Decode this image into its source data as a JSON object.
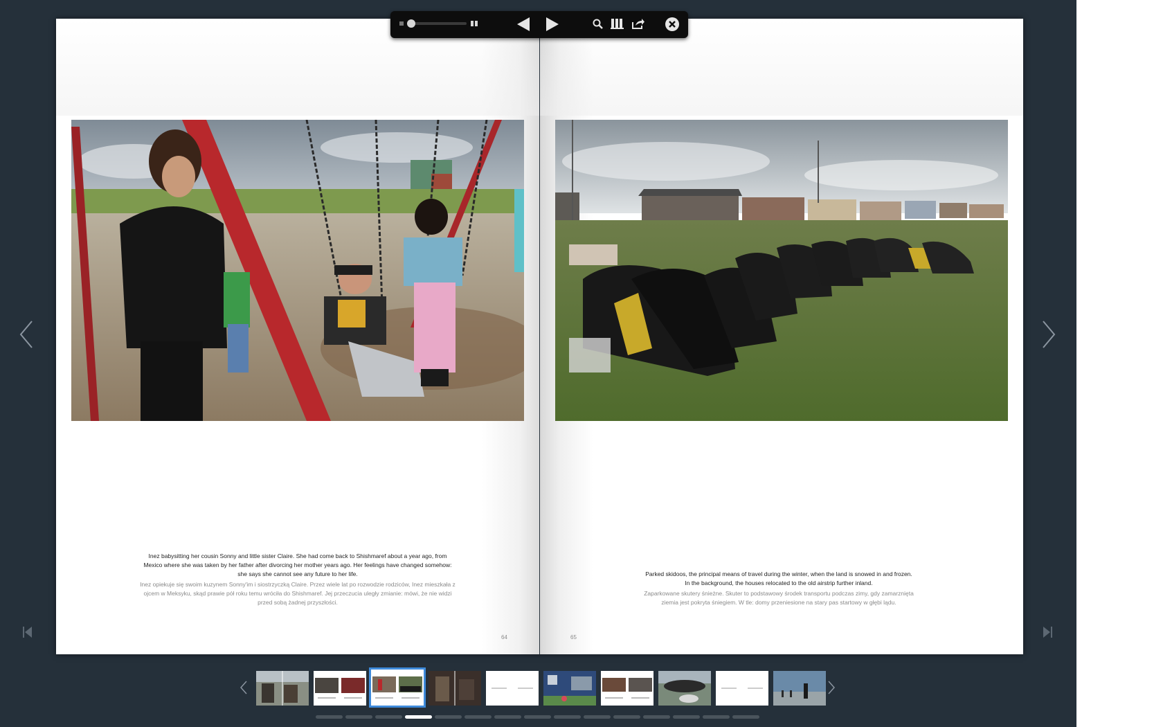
{
  "toolbar": {
    "zoom_small_icon": "zoom-small-icon",
    "zoom_large_icon": "zoom-large-icon",
    "prev_icon": "triangle-left-icon",
    "next_icon": "triangle-right-icon",
    "search_icon": "search-icon",
    "library_icon": "library-icon",
    "share_icon": "share-icon",
    "close_icon": "close-icon",
    "zoom_level": 0
  },
  "spread": {
    "left": {
      "caption_en": "Inez babysitting her cousin Sonny and little sister Claire. She had come back to Shishmaref about a year ago, from Mexico where she was taken by her father after divorcing her mother years ago. Her feelings have changed somehow: she says she cannot see any future to her life.",
      "caption_pl": "Inez opiekuje się swoim kuzynem Sonny'im i siostrzyczką Claire. Przez wiele lat po rozwodzie rodziców, Inez mieszkała z ojcem w Meksyku, skąd prawie pół roku temu wróciła do Shishmaref. Jej przeczucia uległy zmianie: mówi, że nie widzi przed sobą żadnej przyszłości.",
      "page_number": "64"
    },
    "right": {
      "caption_en": "Parked skidoos, the principal means of travel during the winter, when the land is snowed in and frozen. In the background, the houses relocated to the old airstrip further inland.",
      "caption_pl": "Zaparkowane skutery śnieżne. Skuter to podstawowy środek transportu podczas zimy, gdy zamarznięta ziemia jest pokryta śniegiem. W tle: domy przeniesione na stary pas startowy w głębi lądu.",
      "page_number": "65"
    }
  },
  "navigation": {
    "prev_page_icon": "chevron-left-icon",
    "next_page_icon": "chevron-right-icon",
    "first_page_icon": "skip-first-icon",
    "last_page_icon": "skip-last-icon"
  },
  "thumbnails": {
    "count": 10,
    "active_index": 2,
    "page_dots_count": 15,
    "active_dot_index": 3
  },
  "colors": {
    "background": "#25303a",
    "toolbar": "#0d0d0d",
    "active_thumb_border": "#3f8bdb"
  }
}
